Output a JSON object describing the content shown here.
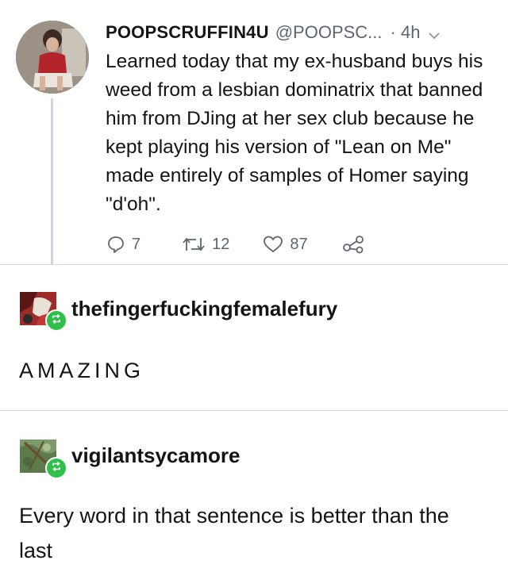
{
  "tweet": {
    "display_name": "POOPSCRUFFIN4U",
    "handle": "@POOPSC...",
    "time": "· 4h",
    "text": "Learned today that my ex-husband buys his weed from a lesbian dominatrix that banned him from DJing at her sex club because he kept playing his version of \"Lean on Me\" made entirely of samples of Homer saying \"d'oh\".",
    "reply_count": "7",
    "retweet_count": "12",
    "like_count": "87",
    "icons": [
      "reply-icon",
      "retweet-icon",
      "like-icon",
      "share-icon",
      "chevron-down-icon"
    ]
  },
  "reblogs": [
    {
      "username": "thefingerfuckingfemalefury",
      "text": "AMAZING"
    },
    {
      "username": "vigilantsycamore",
      "text": "Every word in that sentence is better than the last"
    }
  ],
  "colors": {
    "muted_text": "#5b6670",
    "reblog_badge": "#2fbf4a",
    "divider": "#d6d6d6"
  }
}
